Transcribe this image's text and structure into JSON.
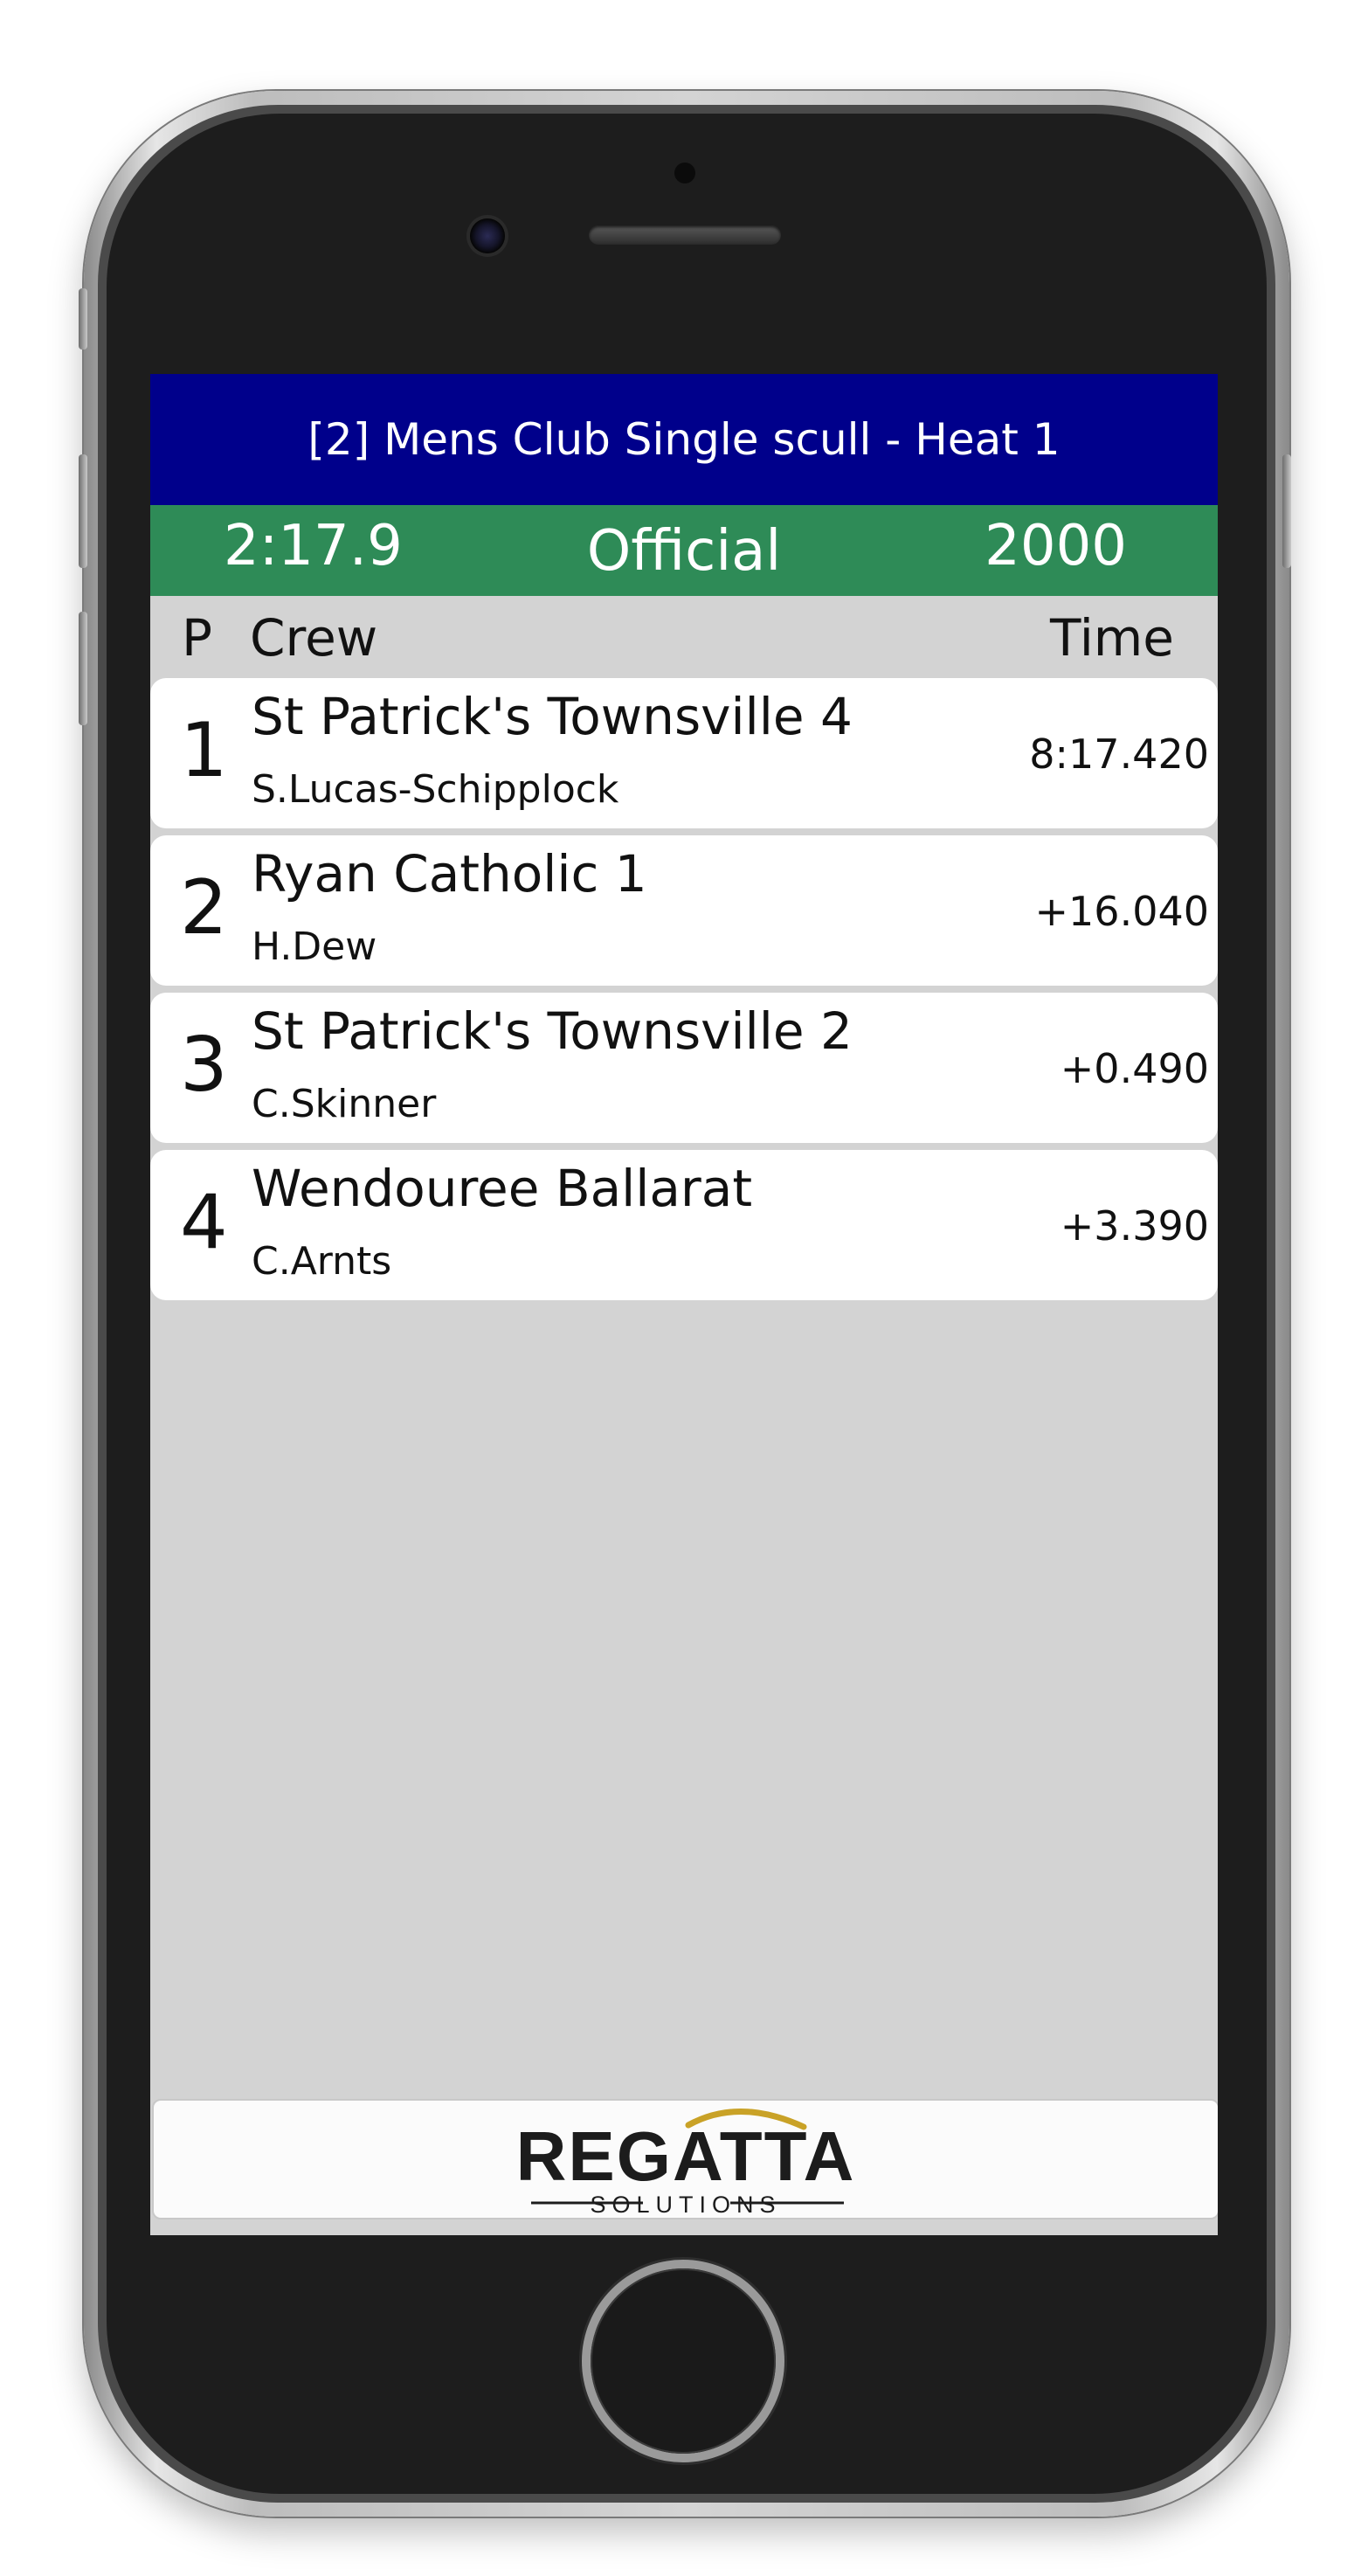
{
  "race": {
    "title": "[2] Mens Club Single scull - Heat 1",
    "elapsed": "2:17.9",
    "status": "Official",
    "distance": "2000"
  },
  "columns": {
    "position": "P",
    "crew": "Crew",
    "time": "Time"
  },
  "results": [
    {
      "position": "1",
      "crew": "St Patrick's Townsville 4",
      "athlete": "S.Lucas-Schipplock",
      "time": "8:17.420"
    },
    {
      "position": "2",
      "crew": "Ryan Catholic 1",
      "athlete": "H.Dew",
      "time": "+16.040"
    },
    {
      "position": "3",
      "crew": "St Patrick's Townsville 2",
      "athlete": "C.Skinner",
      "time": "+0.490"
    },
    {
      "position": "4",
      "crew": "Wendouree Ballarat",
      "athlete": "C.Arnts",
      "time": "+3.390"
    }
  ],
  "footer": {
    "logo_text": "REGATTA",
    "logo_subtext": "SOLUTIONS"
  },
  "colors": {
    "title_bar": "#00008b",
    "status_bar": "#2e8b57",
    "list_background": "#d3d3d3",
    "logo_accent": "#c9a227"
  }
}
